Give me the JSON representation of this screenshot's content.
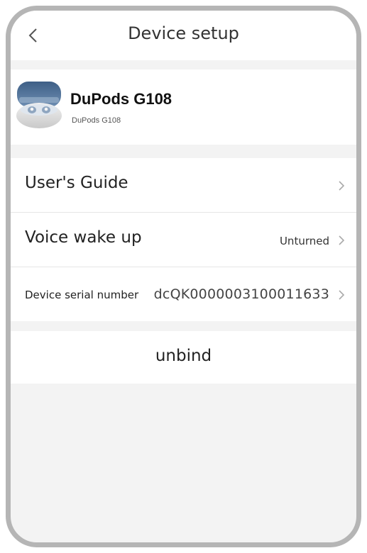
{
  "header": {
    "title": "Device setup"
  },
  "device": {
    "name": "DuPods G108",
    "model": "DuPods G108"
  },
  "settings": {
    "items": [
      {
        "label": "User's Guide",
        "value": ""
      },
      {
        "label": "Voice wake up",
        "value": "Unturned"
      },
      {
        "label": "Device serial number",
        "value": "dcQK0000003100011633"
      }
    ]
  },
  "actions": {
    "unbind_label": "unbind"
  },
  "icons": {
    "back": "chevron-left-icon",
    "row_arrow": "chevron-right-icon",
    "device": "earbuds-case-image"
  },
  "colors": {
    "frame_border": "#b5b5b5",
    "page_background": "#f3f3f3",
    "card_background": "#ffffff",
    "chevron": "#aaaaaa"
  }
}
